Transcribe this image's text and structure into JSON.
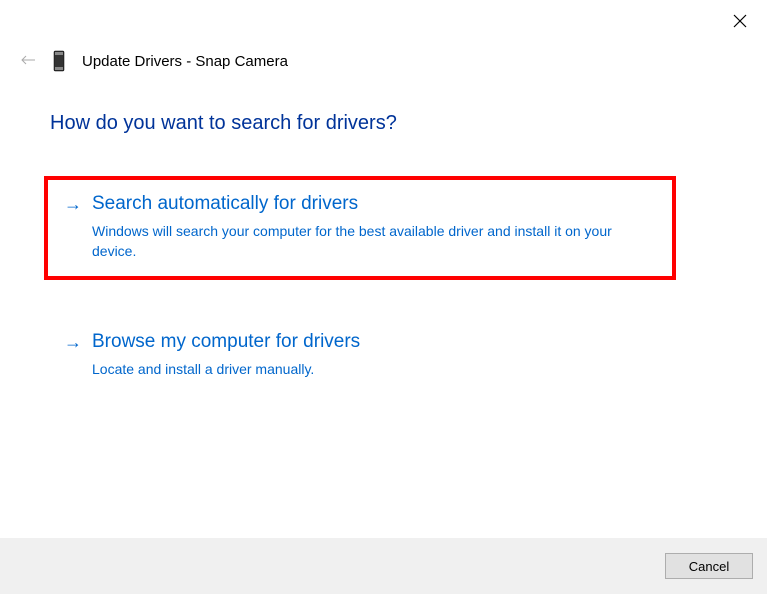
{
  "header": {
    "title": "Update Drivers - Snap Camera"
  },
  "heading": "How do you want to search for drivers?",
  "options": [
    {
      "title": "Search automatically for drivers",
      "description": "Windows will search your computer for the best available driver and install it on your device."
    },
    {
      "title": "Browse my computer for drivers",
      "description": "Locate and install a driver manually."
    }
  ],
  "footer": {
    "cancel_label": "Cancel"
  }
}
